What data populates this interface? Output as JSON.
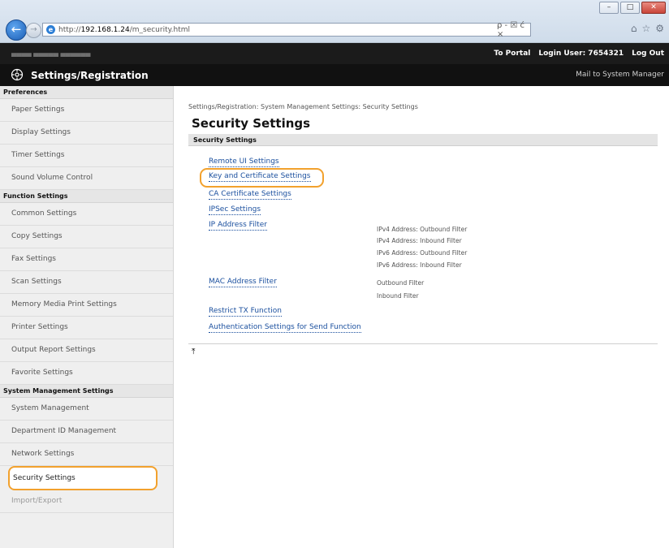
{
  "browser": {
    "url_prefix": "http://",
    "url_host": "192.168.1.24",
    "url_path": "/m_security.html",
    "win_minimize": "–",
    "win_maximize": "□",
    "win_close": "✕",
    "search_tools": "ρ - ☒ ć ×",
    "home_icon": "home-icon",
    "favorites_icon": "star-icon",
    "tools_icon": "gear-icon"
  },
  "header": {
    "to_portal": "To Portal",
    "login_user": "Login User:  7654321",
    "log_out": "Log Out",
    "app_title": "Settings/Registration",
    "mail_link": "Mail to System Manager"
  },
  "sidebar": {
    "groups": [
      {
        "header": "Preferences",
        "items": [
          "Paper Settings",
          "Display Settings",
          "Timer Settings",
          "Sound Volume Control"
        ]
      },
      {
        "header": "Function Settings",
        "items": [
          "Common Settings",
          "Copy Settings",
          "Fax Settings",
          "Scan Settings",
          "Memory Media Print Settings",
          "Printer Settings",
          "Output Report Settings",
          "Favorite Settings"
        ]
      },
      {
        "header": "System Management Settings",
        "items": [
          "System Management",
          "Department ID Management",
          "Network Settings",
          "Security Settings",
          "Import/Export"
        ]
      }
    ]
  },
  "main": {
    "breadcrumb": "Settings/Registration: System Management Settings: Security Settings",
    "page_title": "Security Settings",
    "section_title": "Security Settings",
    "links": {
      "remote_ui": "Remote UI Settings",
      "key_cert": "Key and Certificate Settings",
      "ca_cert": "CA Certificate Settings",
      "ipsec": "IPSec Settings",
      "ip_filter": "IP Address Filter",
      "mac_filter": "MAC Address Filter",
      "restrict_tx": "Restrict TX Function",
      "auth_send": "Authentication Settings for Send Function"
    },
    "ip_filter_subs": [
      "IPv4 Address: Outbound Filter",
      "IPv4 Address: Inbound Filter",
      "IPv6 Address: Outbound Filter",
      "IPv6 Address: Inbound Filter"
    ],
    "mac_filter_subs": [
      "Outbound Filter",
      "Inbound Filter"
    ],
    "top_anchor": "⤒"
  },
  "colors": {
    "highlight": "#f2a12d",
    "link": "#1a4f9e",
    "header_bg": "#111111"
  }
}
